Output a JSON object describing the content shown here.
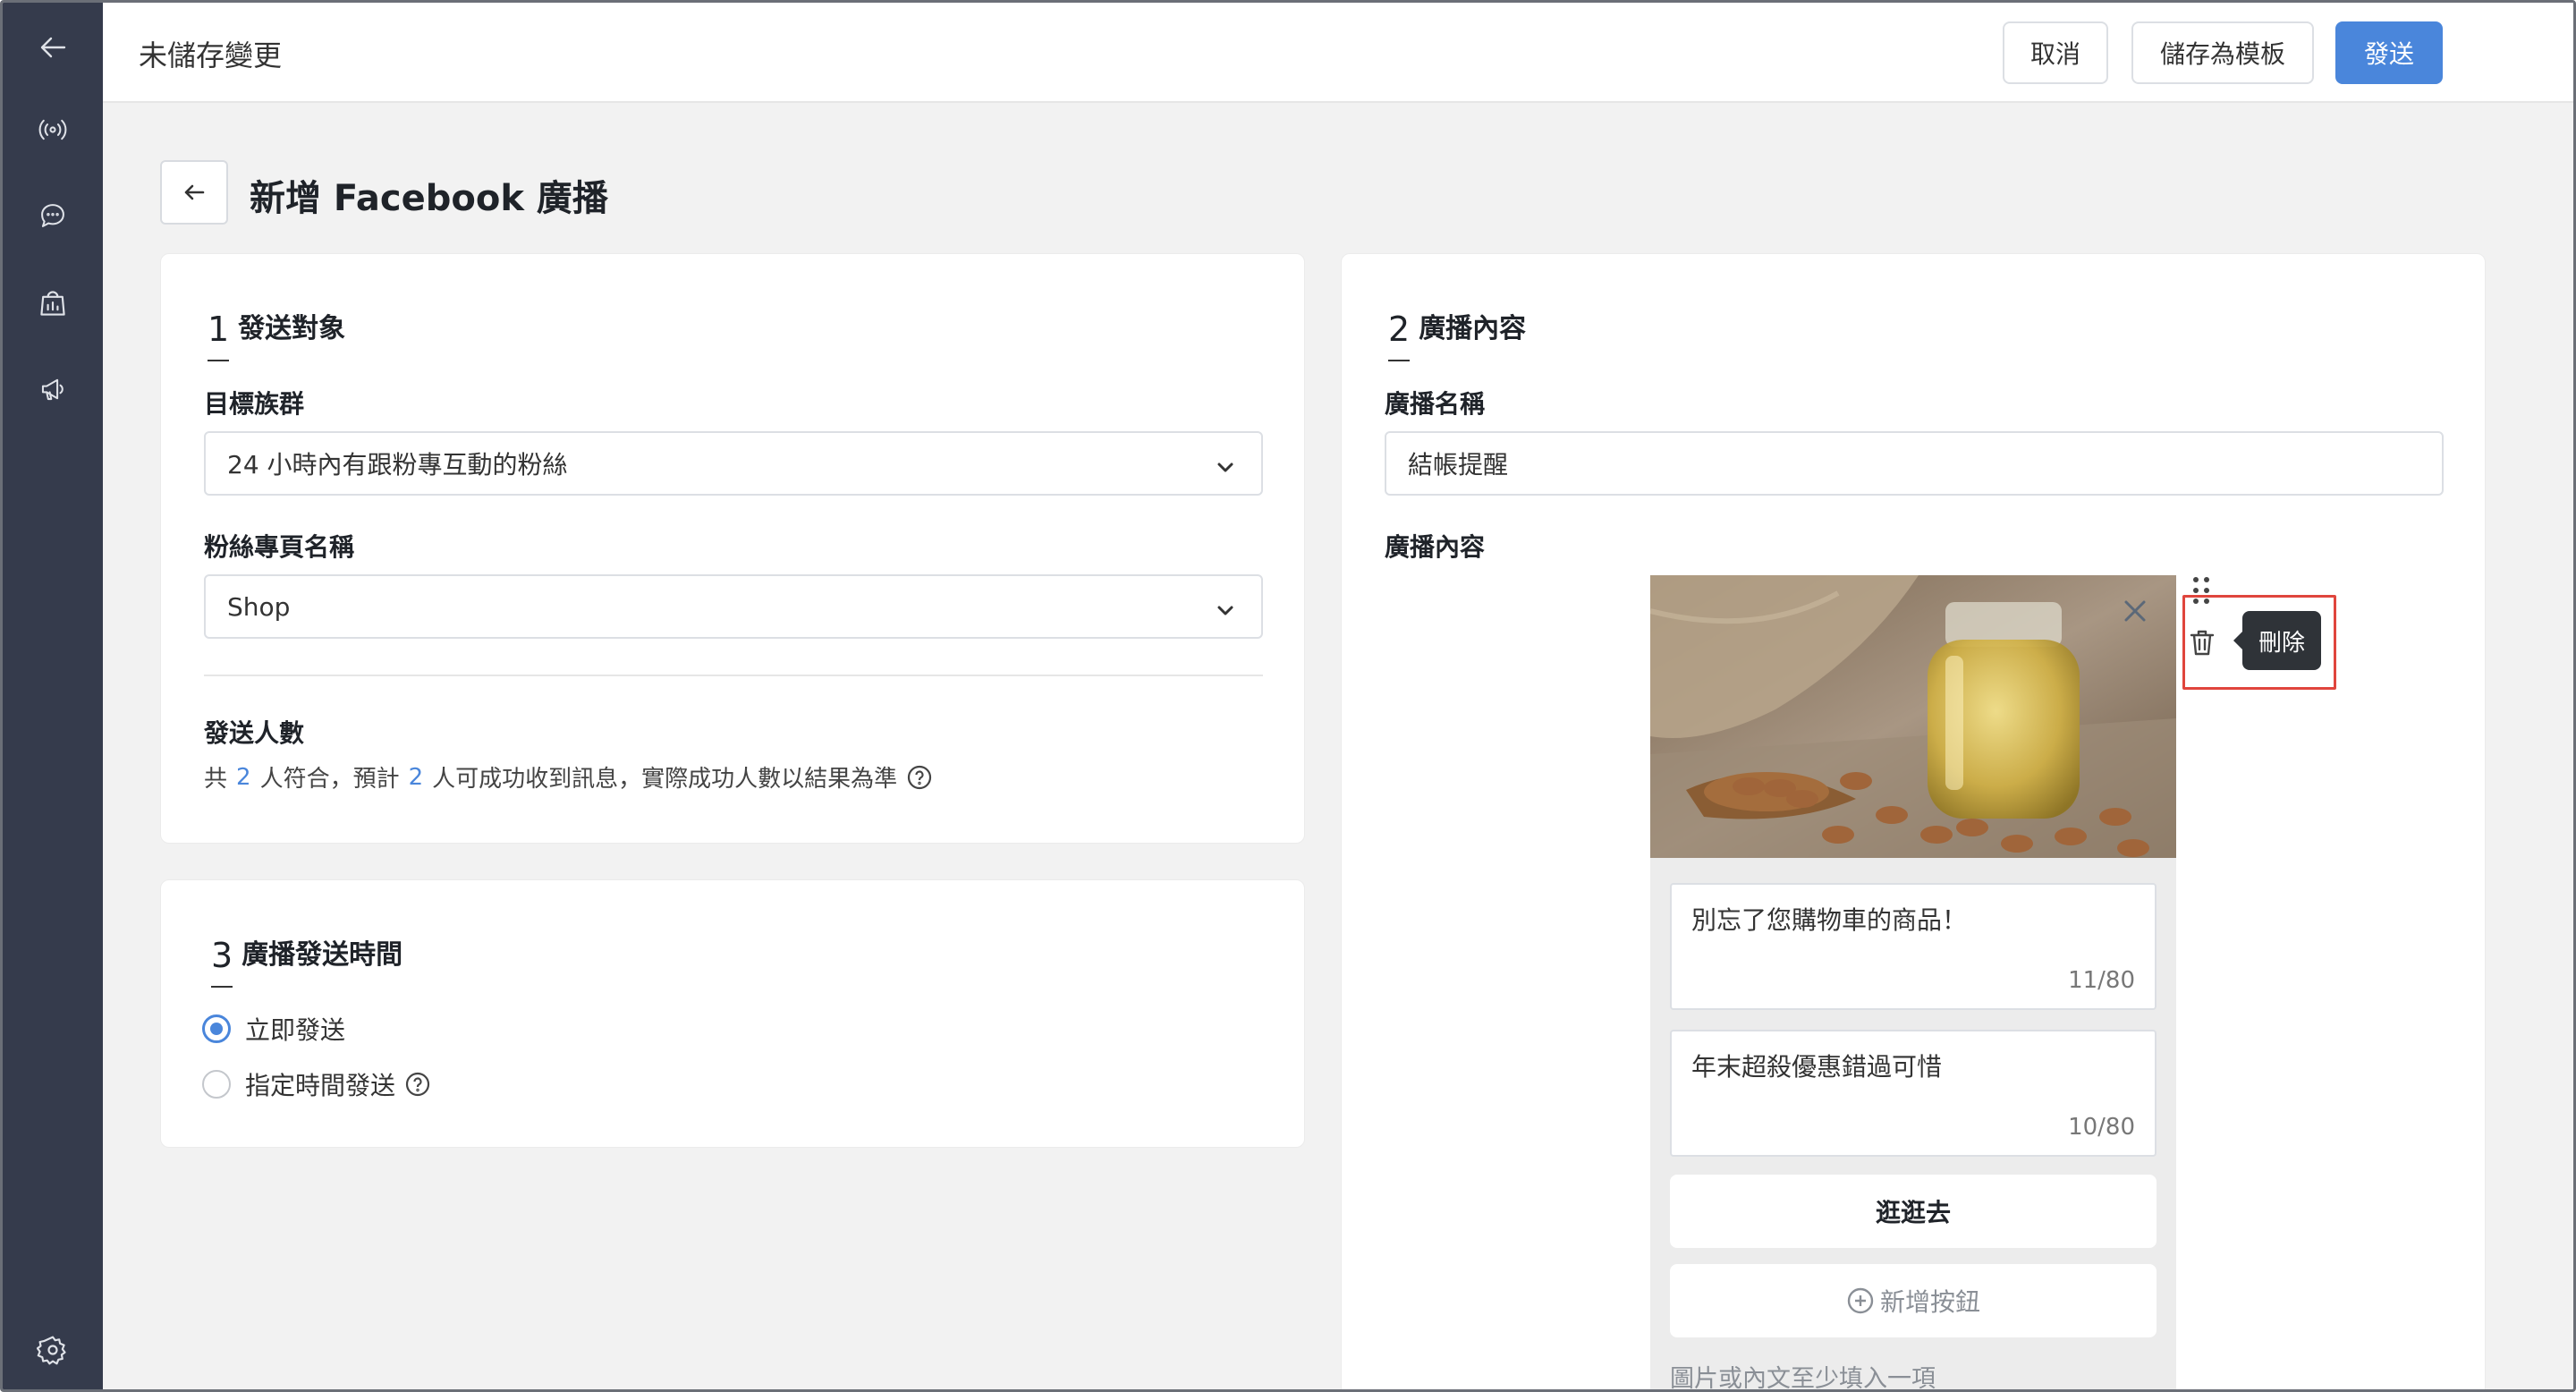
{
  "app": {
    "status_title": "未儲存變更"
  },
  "toolbar": {
    "cancel_label": "取消",
    "save_template_label": "儲存為模板",
    "send_label": "發送"
  },
  "sidebar": {
    "items": [
      {
        "icon": "back-arrow-icon"
      },
      {
        "icon": "broadcast-signal-icon"
      },
      {
        "icon": "chat-bubble-icon"
      },
      {
        "icon": "shop-bag-icon"
      },
      {
        "icon": "megaphone-icon"
      },
      {
        "icon": "gear-icon"
      }
    ]
  },
  "page": {
    "title": "新增 Facebook 廣播"
  },
  "section1": {
    "number": "1",
    "title": "發送對象",
    "target_label": "目標族群",
    "target_value": "24 小時內有跟粉專互動的粉絲",
    "page_label": "粉絲專頁名稱",
    "page_value": "Shop",
    "count_label": "發送人數",
    "count_prefix": "共",
    "matched": "2",
    "count_mid": "人符合，預計",
    "expected": "2",
    "count_suffix": "人可成功收到訊息，實際成功人數以結果為準"
  },
  "section2": {
    "number": "2",
    "title": "廣播內容",
    "name_label": "廣播名稱",
    "name_value": "結帳提醒",
    "content_label": "廣播內容",
    "message_title": "別忘了您購物車的商品！",
    "message_title_count": "11/80",
    "message_subtitle": "年末超殺優惠錯過可惜",
    "message_subtitle_count": "10/80",
    "button_label": "逛逛去",
    "add_button_label": "新增按鈕",
    "hint": "圖片或內文至少填入一項",
    "delete_tooltip": "刪除"
  },
  "section3": {
    "number": "3",
    "title": "廣播發送時間",
    "option_now": "立即發送",
    "option_scheduled": "指定時間發送",
    "selected": "立即發送"
  },
  "colors": {
    "sidebar_bg": "#353b4c",
    "accent": "#4a86db",
    "highlight": "#e0453d"
  }
}
